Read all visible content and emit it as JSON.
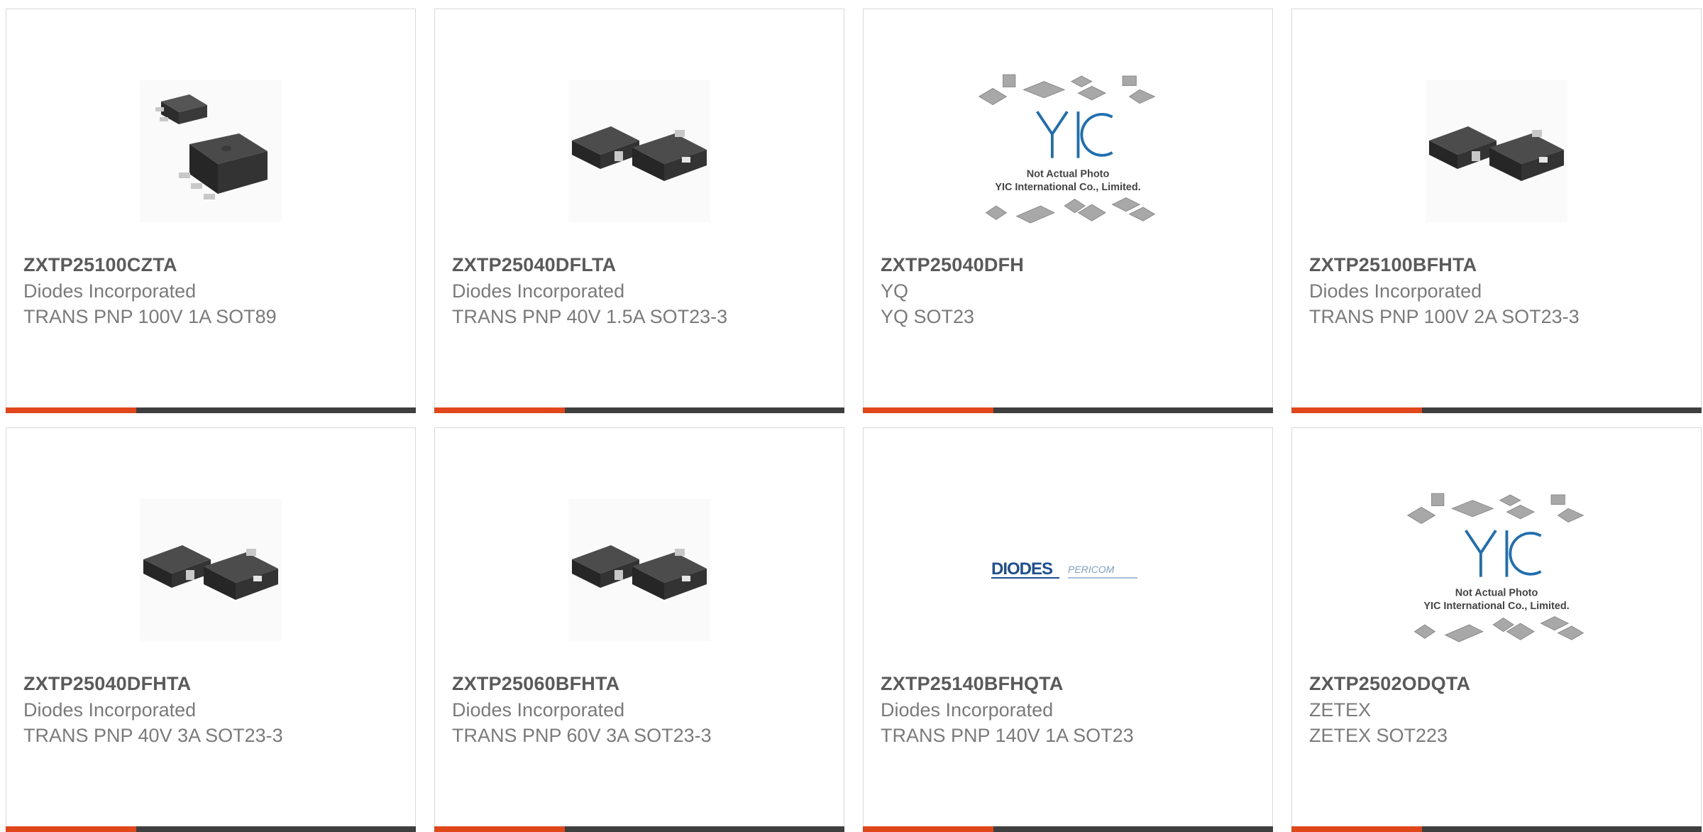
{
  "products": [
    {
      "part": "ZXTP25100CZTA",
      "manufacturer": "Diodes Incorporated",
      "description": "TRANS PNP 100V 1A SOT89",
      "image": "sot89-package-image"
    },
    {
      "part": "ZXTP25040DFLTA",
      "manufacturer": "Diodes Incorporated",
      "description": "TRANS PNP 40V 1.5A SOT23-3",
      "image": "sot23-package-image"
    },
    {
      "part": "ZXTP25040DFH",
      "manufacturer": "YQ",
      "description": "YQ SOT23",
      "image": "not-actual-photo-image",
      "image_text": {
        "line1": "Not Actual Photo",
        "line2": "YIC International Co., Limited.",
        "logo": "YIC"
      }
    },
    {
      "part": "ZXTP25100BFHTA",
      "manufacturer": "Diodes Incorporated",
      "description": "TRANS PNP 100V 2A SOT23-3",
      "image": "sot23-package-image"
    },
    {
      "part": "ZXTP25040DFHTA",
      "manufacturer": "Diodes Incorporated",
      "description": "TRANS PNP 40V 3A SOT23-3",
      "image": "sot23-package-image"
    },
    {
      "part": "ZXTP25060BFHTA",
      "manufacturer": "Diodes Incorporated",
      "description": "TRANS PNP 60V 3A SOT23-3",
      "image": "sot23-package-image"
    },
    {
      "part": "ZXTP25140BFHQTA",
      "manufacturer": "Diodes Incorporated",
      "description": "TRANS PNP 140V 1A SOT23",
      "image": "diodes-pericom-logo-image",
      "image_text": {
        "logo1": "DIODES",
        "logo2": "PERICOM"
      }
    },
    {
      "part": "ZXTP2502ODQTA",
      "manufacturer": "ZETEX",
      "description": "ZETEX SOT223",
      "image": "not-actual-photo-image",
      "image_text": {
        "line1": "Not Actual Photo",
        "line2": "YIC International Co., Limited.",
        "logo": "YIC"
      }
    }
  ],
  "colors": {
    "accent": "#e0471a",
    "bar": "#3f3f3f",
    "title": "#5a5a5a",
    "text": "#7a7a7a"
  }
}
